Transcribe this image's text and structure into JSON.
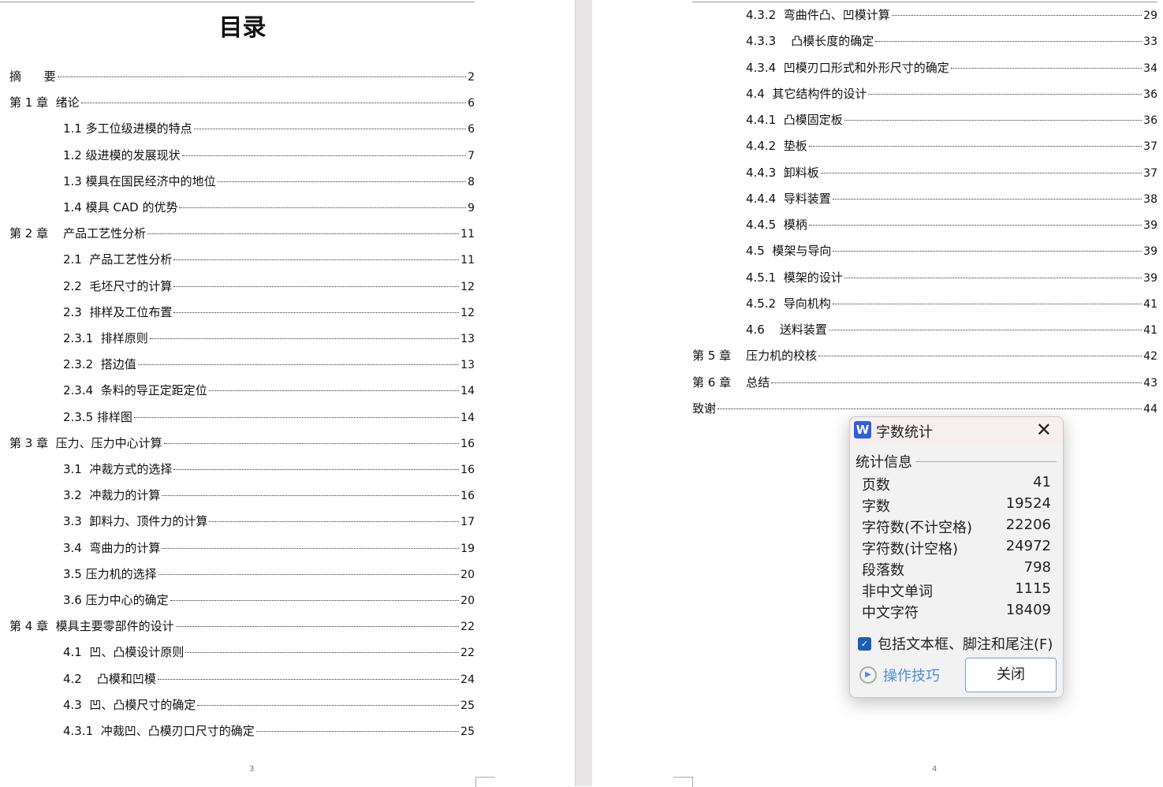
{
  "left_page": {
    "title": "目录",
    "page_number": "3",
    "entries": [
      {
        "label": "摘      要",
        "page": "2",
        "level": 0
      },
      {
        "label": "第 1 章  绪论",
        "page": "6",
        "level": 0
      },
      {
        "label": "1.1 多工位级进模的特点",
        "page": "6",
        "level": 1
      },
      {
        "label": "1.2 级进模的发展现状",
        "page": "7",
        "level": 1
      },
      {
        "label": "1.3 模具在国民经济中的地位",
        "page": "8",
        "level": 1
      },
      {
        "label": "1.4 模具 CAD 的优势",
        "page": "9",
        "level": 1
      },
      {
        "label": "第 2 章    产品工艺性分析",
        "page": "11",
        "level": 0
      },
      {
        "label": "2.1  产品工艺性分析",
        "page": "11",
        "level": 1
      },
      {
        "label": "2.2  毛坯尺寸的计算",
        "page": "12",
        "level": 1
      },
      {
        "label": "2.3  排样及工位布置",
        "page": "12",
        "level": 1
      },
      {
        "label": "2.3.1  排样原则",
        "page": "13",
        "level": 1
      },
      {
        "label": "2.3.2  搭边值",
        "page": "13",
        "level": 1
      },
      {
        "label": "2.3.4  条料的导正定距定位",
        "page": "14",
        "level": 1
      },
      {
        "label": "2.3.5 排样图",
        "page": "14",
        "level": 1
      },
      {
        "label": "第 3 章  压力、压力中心计算",
        "page": "16",
        "level": 0
      },
      {
        "label": "3.1  冲裁方式的选择",
        "page": "16",
        "level": 1
      },
      {
        "label": "3.2  冲裁力的计算",
        "page": "16",
        "level": 1
      },
      {
        "label": "3.3  卸料力、顶件力的计算",
        "page": "17",
        "level": 1
      },
      {
        "label": "3.4  弯曲力的计算",
        "page": "19",
        "level": 1
      },
      {
        "label": "3.5 压力机的选择",
        "page": "20",
        "level": 1
      },
      {
        "label": "3.6 压力中心的确定",
        "page": "20",
        "level": 1
      },
      {
        "label": "第 4 章  模具主要零部件的设计",
        "page": "22",
        "level": 0
      },
      {
        "label": "4.1  凹、凸模设计原则",
        "page": "22",
        "level": 1
      },
      {
        "label": "4.2    凸模和凹模",
        "page": "24",
        "level": 1
      },
      {
        "label": "4.3  凹、凸模尺寸的确定",
        "page": "25",
        "level": 1
      },
      {
        "label": "4.3.1  冲裁凹、凸模刃口尺寸的确定",
        "page": "25",
        "level": 1
      }
    ]
  },
  "right_page": {
    "page_number": "4",
    "entries": [
      {
        "label": "4.3.2  弯曲件凸、凹模计算",
        "page": "29",
        "level": 1
      },
      {
        "label": "4.3.3    凸模长度的确定",
        "page": "33",
        "level": 1
      },
      {
        "label": "4.3.4  凹模刃口形式和外形尺寸的确定",
        "page": "34",
        "level": 1
      },
      {
        "label": "4.4  其它结构件的设计",
        "page": "36",
        "level": 1
      },
      {
        "label": "4.4.1  凸模固定板",
        "page": "36",
        "level": 1
      },
      {
        "label": "4.4.2  垫板",
        "page": "37",
        "level": 1
      },
      {
        "label": "4.4.3  卸料板",
        "page": "37",
        "level": 1
      },
      {
        "label": "4.4.4  导料装置",
        "page": "38",
        "level": 1
      },
      {
        "label": "4.4.5  模柄",
        "page": "39",
        "level": 1
      },
      {
        "label": "4.5  模架与导向",
        "page": "39",
        "level": 1
      },
      {
        "label": "4.5.1  模架的设计",
        "page": "39",
        "level": 1
      },
      {
        "label": "4.5.2  导向机构",
        "page": "41",
        "level": 1
      },
      {
        "label": "4.6    送料装置",
        "page": "41",
        "level": 1
      },
      {
        "label": "第 5 章    压力机的校核",
        "page": "42",
        "level": 0
      },
      {
        "label": "第 6 章    总结",
        "page": "43",
        "level": 0
      },
      {
        "label": "致谢",
        "page": "44",
        "level": 0
      }
    ]
  },
  "dialog": {
    "logo": "W",
    "title": "字数统计",
    "group": "统计信息",
    "stats": [
      {
        "label": "页数",
        "value": "41"
      },
      {
        "label": "字数",
        "value": "19524"
      },
      {
        "label": "字符数(不计空格)",
        "value": "22206"
      },
      {
        "label": "字符数(计空格)",
        "value": "24972"
      },
      {
        "label": "段落数",
        "value": "798"
      },
      {
        "label": "非中文单词",
        "value": "1115"
      },
      {
        "label": "中文字符",
        "value": "18409"
      }
    ],
    "checkbox_label": "包括文本框、脚注和尾注(F)",
    "checkbox_checked": true,
    "tips_label": "操作技巧",
    "close_label": "关闭"
  }
}
